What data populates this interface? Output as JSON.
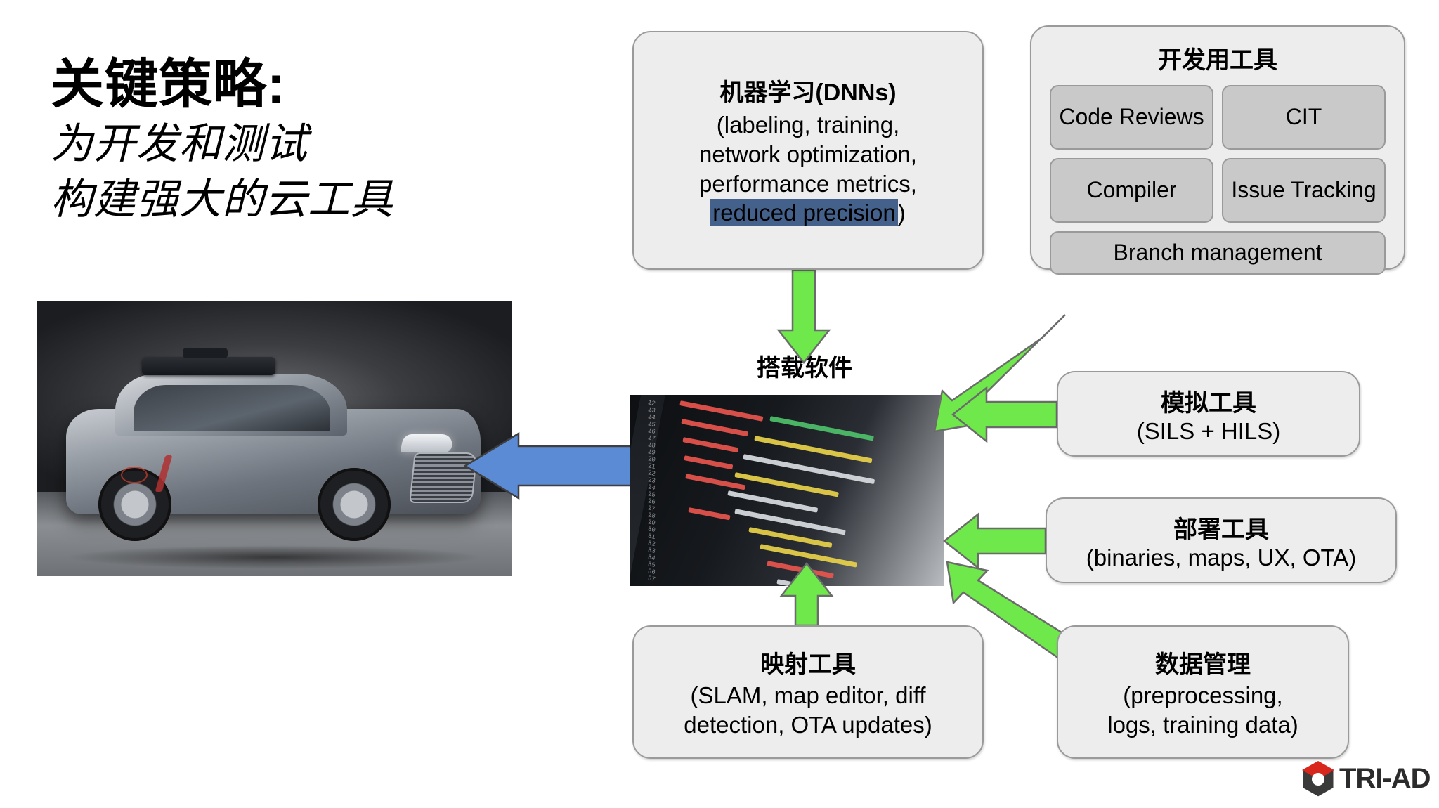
{
  "title": {
    "main": "关键策略:",
    "sub_line1": "为开发和测试",
    "sub_line2": "构建强大的云工具"
  },
  "machine_learning": {
    "heading": "机器学习(DNNs)",
    "line1": "(labeling, training,",
    "line2": "network optimization,",
    "line3": "performance metrics,",
    "highlighted": "reduced precision",
    "line4_tail": ")",
    "highlight_color": "#44618C"
  },
  "dev_tools": {
    "heading": "开发用工具",
    "chips": [
      {
        "label": "Code Reviews",
        "span": "half"
      },
      {
        "label": "CIT",
        "span": "half"
      },
      {
        "label": "Compiler",
        "span": "half"
      },
      {
        "label": "Issue Tracking",
        "span": "half"
      },
      {
        "label": "Branch management",
        "span": "full"
      }
    ]
  },
  "onboard": {
    "label": "搭载软件"
  },
  "simulation": {
    "heading": "模拟工具",
    "detail": "(SILS + HILS)"
  },
  "deployment": {
    "heading": "部署工具",
    "detail": "(binaries, maps, UX, OTA)"
  },
  "data_management": {
    "heading": "数据管理",
    "line1": "(preprocessing,",
    "line2": "logs, training data)"
  },
  "mapping": {
    "heading": "映射工具",
    "line1": "(SLAM, map editor, diff",
    "line2": "detection, OTA updates)"
  },
  "logo": {
    "text": "TRI-AD"
  },
  "colors": {
    "card_fill": "#EDEDED",
    "card_border": "#9A9A9A",
    "chip_fill": "#C9C9C9",
    "green_arrow": "#6EE84A",
    "green_arrow_border": "#6B6B6B",
    "blue_arrow": "#5B8BD5",
    "blue_arrow_border": "#3F3F3F",
    "highlight": "#44618C"
  },
  "icons": {
    "logo_mark": "hexagon-logo-icon",
    "car": "autonomous-car-photo",
    "code": "source-code-photo"
  }
}
